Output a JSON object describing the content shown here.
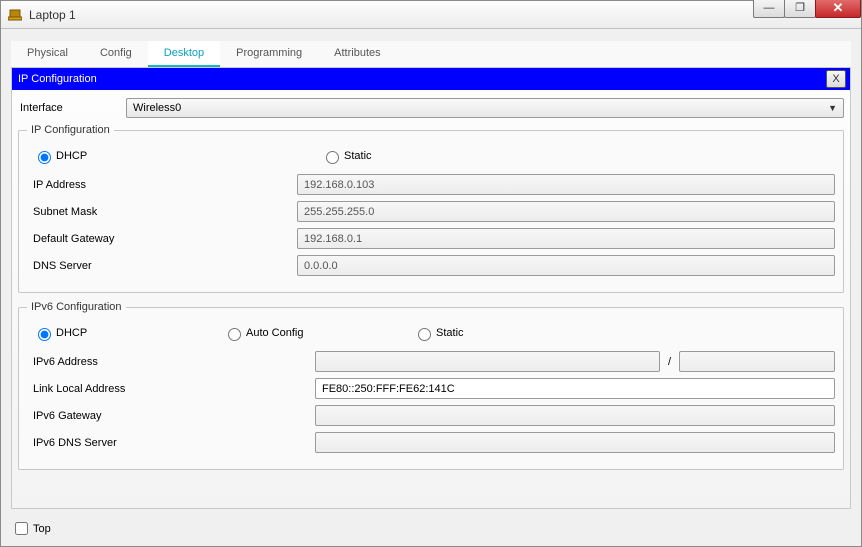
{
  "window": {
    "title": "Laptop 1"
  },
  "winControls": {
    "min": "—",
    "max": "❐",
    "close": "✕"
  },
  "tabs": [
    {
      "label": "Physical",
      "active": false
    },
    {
      "label": "Config",
      "active": false
    },
    {
      "label": "Desktop",
      "active": true
    },
    {
      "label": "Programming",
      "active": false
    },
    {
      "label": "Attributes",
      "active": false
    }
  ],
  "panel": {
    "title": "IP Configuration",
    "close": "X"
  },
  "interface": {
    "label": "Interface",
    "value": "Wireless0"
  },
  "ipv4": {
    "legend": "IP Configuration",
    "radios": {
      "dhcp": "DHCP",
      "static": "Static",
      "selected": "dhcp"
    },
    "fields": {
      "ip": {
        "label": "IP Address",
        "value": "192.168.0.103"
      },
      "mask": {
        "label": "Subnet Mask",
        "value": "255.255.255.0"
      },
      "gw": {
        "label": "Default Gateway",
        "value": "192.168.0.1"
      },
      "dns": {
        "label": "DNS Server",
        "value": "0.0.0.0"
      }
    }
  },
  "ipv6": {
    "legend": "IPv6 Configuration",
    "radios": {
      "dhcp": "DHCP",
      "auto": "Auto Config",
      "static": "Static",
      "selected": "dhcp"
    },
    "fields": {
      "addr": {
        "label": "IPv6 Address",
        "value": "",
        "prefix": "",
        "sep": "/"
      },
      "lla": {
        "label": "Link Local Address",
        "value": "FE80::250:FFF:FE62:141C"
      },
      "gw": {
        "label": "IPv6 Gateway",
        "value": ""
      },
      "dns": {
        "label": "IPv6 DNS Server",
        "value": ""
      }
    }
  },
  "footer": {
    "top": "Top"
  }
}
